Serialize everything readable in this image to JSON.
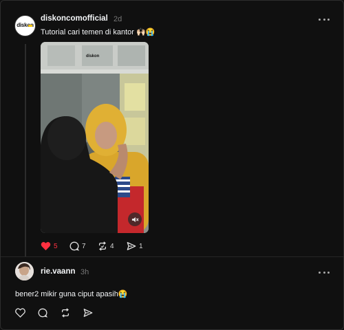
{
  "post": {
    "avatar_logo_text": "diskon",
    "username": "diskoncomofficial",
    "time": "2d",
    "text": "Tutorial cari temen di kantor 🙌🏻😭",
    "video": {
      "watermark_text": "diskon"
    },
    "actions": {
      "likes": "5",
      "comments": "7",
      "reposts": "4",
      "shares": "1"
    },
    "liked": true,
    "like_color": "#ff3040"
  },
  "reply": {
    "username": "rie.vaann",
    "time": "3h",
    "text": "bener2 mikir guna ciput apasih😭"
  },
  "icons": {
    "more": "more-icon",
    "like": "heart-icon",
    "comment": "comment-icon",
    "repost": "repost-icon",
    "share": "share-icon",
    "mute": "mute-icon"
  }
}
